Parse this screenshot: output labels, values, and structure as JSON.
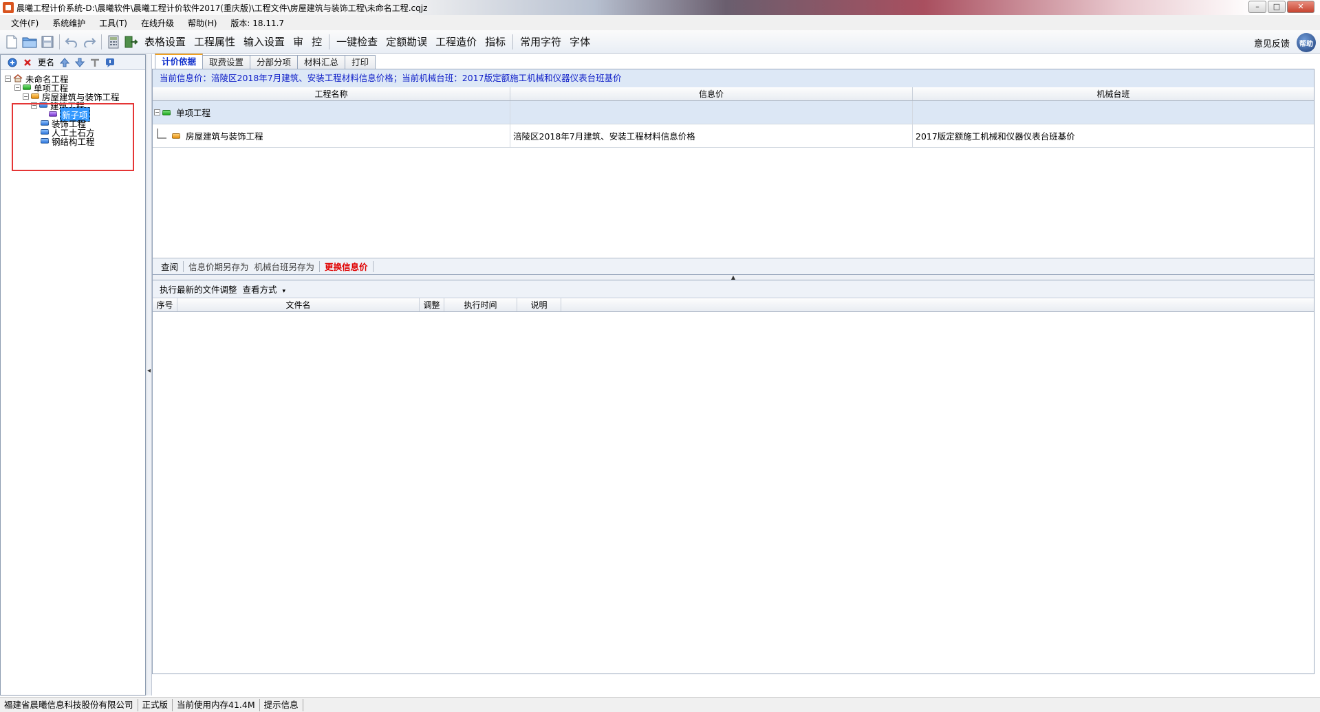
{
  "window": {
    "title": "晨曦工程计价系统-D:\\晨曦软件\\晨曦工程计价软件2017(重庆版)\\工程文件\\房屋建筑与装饰工程\\未命名工程.cqjz",
    "min": "–",
    "max": "□",
    "close": "✕"
  },
  "menu": {
    "items": [
      "文件(F)",
      "系统维护",
      "工具(T)",
      "在线升级",
      "帮助(H)",
      "版本: 18.11.7"
    ]
  },
  "toolbar": {
    "text_buttons": [
      "表格设置",
      "工程属性",
      "输入设置",
      "审",
      "控",
      "一键检查",
      "定额勘误",
      "工程造价",
      "指标",
      "常用字符",
      "字体"
    ],
    "feedback": "意见反馈",
    "help_label": "帮助"
  },
  "left_panel": {
    "rename": "更名",
    "tree": [
      {
        "label": "未命名工程"
      },
      {
        "label": "单项工程"
      },
      {
        "label": "房屋建筑与装饰工程"
      },
      {
        "label": "建筑工程"
      },
      {
        "label": "新子项"
      },
      {
        "label": "装饰工程"
      },
      {
        "label": "人工土石方"
      },
      {
        "label": "钢结构工程"
      }
    ]
  },
  "tabs": [
    "计价依据",
    "取费设置",
    "分部分项",
    "材料汇总",
    "打印"
  ],
  "info_line": "当前信息价：涪陵区2018年7月建筑、安装工程材料信息价格；当前机械台班：2017版定额施工机械和仪器仪表台班基价",
  "grid1": {
    "columns": [
      "工程名称",
      "信息价",
      "机械台班"
    ],
    "rows": [
      {
        "name": "单项工程",
        "info": "",
        "machine": ""
      },
      {
        "name": "房屋建筑与装饰工程",
        "info": "涪陵区2018年7月建筑、安装工程材料信息价格",
        "machine": "2017版定额施工机械和仪器仪表台班基价"
      }
    ],
    "buttons": [
      "查阅",
      "信息价期另存为",
      "机械台班另存为",
      "更换信息价"
    ]
  },
  "panel2": {
    "toolbar": [
      "执行最新的文件调整",
      "查看方式"
    ],
    "columns": [
      "序号",
      "文件名",
      "调整",
      "执行时间",
      "说明"
    ]
  },
  "statusbar": [
    "福建省晨曦信息科技股份有限公司",
    "正式版",
    "当前使用内存41.4M",
    "提示信息"
  ]
}
